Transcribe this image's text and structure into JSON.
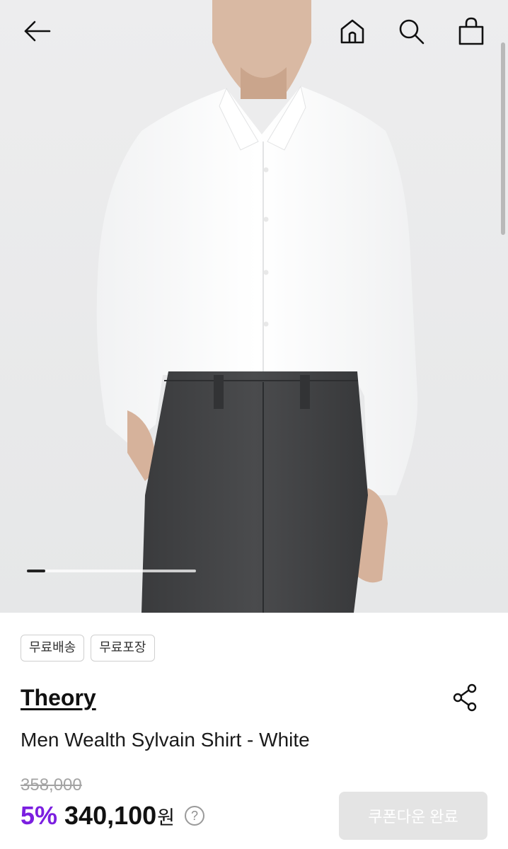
{
  "header": {
    "back_icon": "arrow-left-icon",
    "home_icon": "home-icon",
    "search_icon": "search-icon",
    "cart_icon": "shopping-bag-icon"
  },
  "gallery": {
    "current_index": 1,
    "progress": 0.11
  },
  "badges": [
    "무료배송",
    "무료포장"
  ],
  "product": {
    "brand": "Theory",
    "name": "Men Wealth Sylvain Shirt - White",
    "original_price": "358,000",
    "discount": "5%",
    "price": "340,100",
    "currency": "원",
    "help_icon": "question-circle-icon",
    "share_icon": "share-icon"
  },
  "coupon": {
    "label": "쿠폰다운 완료",
    "state": "disabled"
  },
  "colors": {
    "discount": "#7b1fe0",
    "coupon_bg": "#e4e4e4",
    "badge_border": "#cfcfcf"
  }
}
